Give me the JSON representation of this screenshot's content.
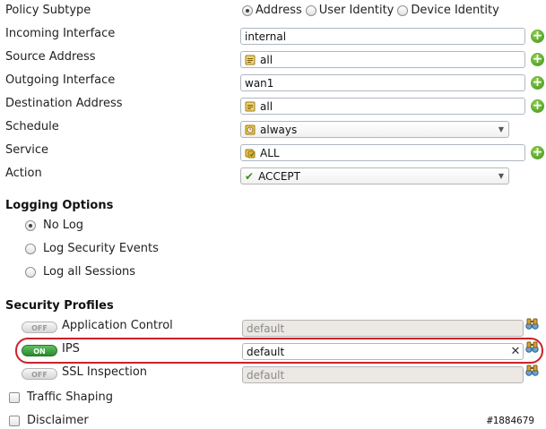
{
  "policy": {
    "subtype": {
      "label": "Policy Subtype",
      "options": [
        "Address",
        "User Identity",
        "Device Identity"
      ],
      "selected": "Address"
    },
    "incoming_interface": {
      "label": "Incoming Interface",
      "value": "internal"
    },
    "source_address": {
      "label": "Source Address",
      "value": "all"
    },
    "outgoing_interface": {
      "label": "Outgoing Interface",
      "value": "wan1"
    },
    "destination_address": {
      "label": "Destination Address",
      "value": "all"
    },
    "schedule": {
      "label": "Schedule",
      "value": "always"
    },
    "service": {
      "label": "Service",
      "value": "ALL"
    },
    "action": {
      "label": "Action",
      "value": "ACCEPT",
      "check_glyph": "✔"
    }
  },
  "logging": {
    "title": "Logging Options",
    "options": [
      "No Log",
      "Log Security Events",
      "Log all Sessions"
    ],
    "selected": "No Log"
  },
  "security_profiles": {
    "title": "Security Profiles",
    "items": [
      {
        "name": "Application Control",
        "state": "OFF",
        "value": "default",
        "enabled": false
      },
      {
        "name": "IPS",
        "state": "ON",
        "value": "default",
        "enabled": true,
        "clear_glyph": "✕"
      },
      {
        "name": "SSL Inspection",
        "state": "OFF",
        "value": "default",
        "enabled": false
      }
    ]
  },
  "extras": {
    "traffic_shaping": "Traffic Shaping",
    "disclaimer": "Disclaimer"
  },
  "watermark": "#1884679",
  "icons": {
    "add": "+",
    "caret": "▼"
  },
  "colors": {
    "highlight_border": "#c8232c",
    "toggle_on": "#2c8a2e",
    "add_icon": "#3f8f1c"
  }
}
